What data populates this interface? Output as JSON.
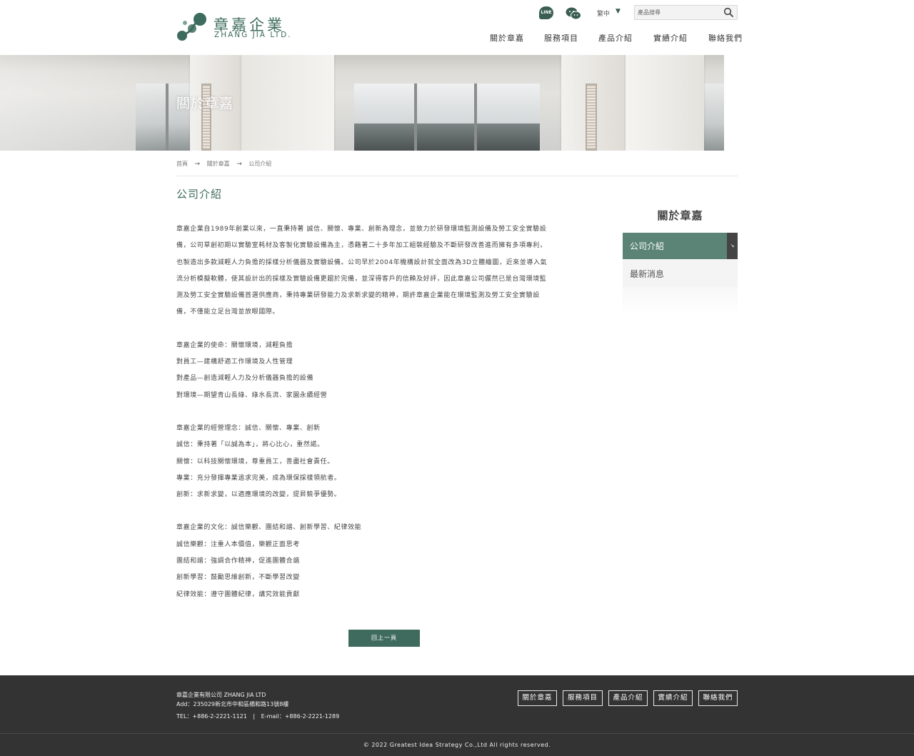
{
  "brand": {
    "name_cn": "章嘉企業",
    "name_en": "ZHANG JIA LTD.",
    "color_primary": "#3d6b5d",
    "color_dark": "#333333"
  },
  "header": {
    "line_label": "LINE",
    "language": "繁中",
    "language_caret": "▼",
    "search_placeholder": "產品搜尋",
    "nav": [
      "關於章嘉",
      "服務項目",
      "產品介紹",
      "實績介紹",
      "聯絡我們"
    ]
  },
  "banner": {
    "title": "關於章嘉"
  },
  "breadcrumb": [
    "首頁",
    "關於章嘉",
    "公司介紹"
  ],
  "page_title": "公司介紹",
  "content": {
    "intro_lines": [
      "章嘉企業自1989年創業以來，一直秉持著 誠信、關懷、專業、創新為理念，並致力於研發環境監測設備及勞工安全實驗設",
      "備，公司草創初期以實驗室耗材及客製化實驗設備為主，憑藉著二十多年加工組裝經驗及不斷研發改善進而擁有多項專利，",
      "也製造出多款減輕人力負擔的採樣分析儀器及實驗設備。公司早於2004年機構設計就全面改為3D立體繪圖，近來並導入氣",
      "流分析模擬軟體，使其設計出的採樣及實驗設備更趨於完備，並深得客戶的信賴及好評，因此章嘉公司儼然已是台灣環境監",
      "測及勞工安全實驗設備首選供應商，秉持專業研發能力及求新求變的精神，期許章嘉企業能在環境監測及勞工安全實驗設",
      "備，不僅能立足台灣並放眼國際。"
    ],
    "mission": [
      "章嘉企業的使命：關懷環境，減輕負擔",
      "對員工—建構舒適工作環境及人性管理",
      "對產品—創造減輕人力及分析儀器負擔的設備",
      "對環境—期望青山長綠、綠水長流、家園永續經營"
    ],
    "philosophy": [
      "章嘉企業的經營理念：誠信、關懷、專業、創新",
      "誠信：秉持著「以誠為本」，將心比心，重然諾。",
      "關懷：以科技關懷環境，尊重員工，善盡社會責任。",
      "專業：充分發揮專業追求完美，成為環保採樣領航者。",
      "創新：求新求變，以適應環境的改變，提昇競爭優勢。"
    ],
    "culture": [
      "章嘉企業的文化：誠信樂觀、團結和諧、創新學習、紀律效能",
      "誠信樂觀：注重人本價值，樂觀正面思考",
      "團結和諧：強調合作精神，促進團體合諧",
      "創新學習：鼓勵思維創新，不斷學習改變",
      "紀律效能：遵守團體紀律，講究效能貢獻"
    ],
    "back_button": "回上一頁"
  },
  "sidebar": {
    "title": "關於章嘉",
    "items": [
      {
        "label": "公司介紹",
        "active": true,
        "arrow": "↘"
      },
      {
        "label": "最新消息",
        "active": false
      }
    ]
  },
  "footer": {
    "company": "章嘉企業有限公司 ZHANG JIA LTD",
    "address": "Add：235029新北市中和區橋和路13號8樓",
    "tel": "TEL：+886-2-2221-1121",
    "separator": "|",
    "email": "E-mail：+886-2-2221-1289",
    "nav": [
      "關於章嘉",
      "服務項目",
      "產品介紹",
      "實績介紹",
      "聯絡我們"
    ],
    "copyright": "© 2022 Greatest Idea Strategy Co.,Ltd All rights reserved."
  }
}
